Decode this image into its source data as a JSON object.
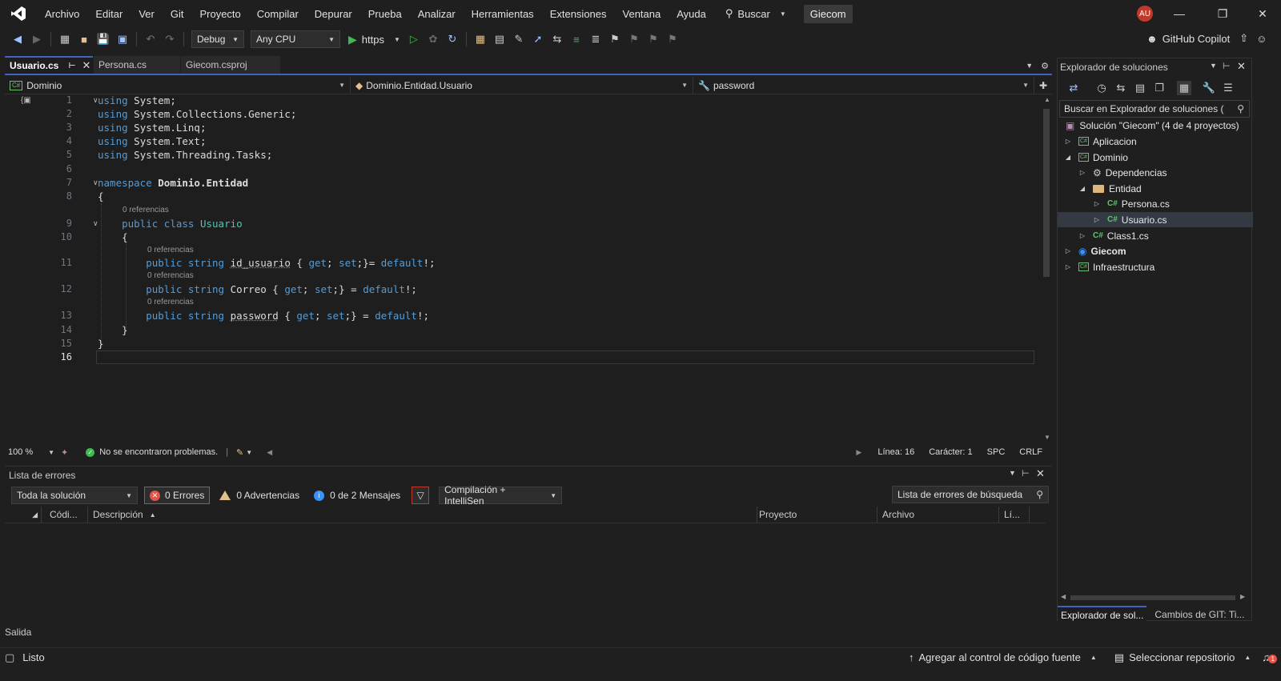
{
  "menu": [
    "Archivo",
    "Editar",
    "Ver",
    "Git",
    "Proyecto",
    "Compilar",
    "Depurar",
    "Prueba",
    "Analizar",
    "Herramientas",
    "Extensiones",
    "Ventana",
    "Ayuda"
  ],
  "search_label": "Buscar",
  "solution_badge": "Giecom",
  "avatar_initials": "AU",
  "toolbar": {
    "config": "Debug",
    "platform": "Any CPU",
    "run_target": "https",
    "copilot": "GitHub Copilot"
  },
  "tabs": [
    {
      "label": "Usuario.cs",
      "active": true
    },
    {
      "label": "Persona.cs",
      "active": false
    },
    {
      "label": "Giecom.csproj",
      "active": false
    }
  ],
  "nav": {
    "project": "Dominio",
    "type": "Dominio.Entidad.Usuario",
    "member": "password"
  },
  "code": {
    "line_numbers": [
      "1",
      "2",
      "3",
      "4",
      "5",
      "6",
      "7",
      "8",
      "9",
      "10",
      "11",
      "12",
      "13",
      "14",
      "15",
      "16"
    ],
    "refs_label": "0 referencias",
    "using": "using",
    "usings": [
      "System",
      "System.Collections.Generic",
      "System.Linq",
      "System.Text",
      "System.Threading.Tasks"
    ],
    "namespace_kw": "namespace",
    "namespace_name": "Dominio.Entidad",
    "public_kw": "public",
    "class_kw": "class",
    "class_name": "Usuario",
    "string_kw": "string",
    "get_kw": "get",
    "set_kw": "set",
    "default_kw": "default",
    "props": [
      "id_usuario",
      "Correo",
      "password"
    ]
  },
  "editor_status": {
    "zoom": "100 %",
    "problems": "No se encontraron problemas.",
    "line": "Línea: 16",
    "char": "Carácter: 1",
    "spc": "SPC",
    "eol": "CRLF"
  },
  "errors": {
    "title": "Lista de errores",
    "scope": "Toda la solución",
    "errors_label": "0 Errores",
    "warnings_label": "0 Advertencias",
    "messages_label": "0 de 2 Mensajes",
    "build_filter": "Compilación + IntelliSen",
    "search_placeholder": "Lista de errores de búsqueda",
    "columns": [
      "Códi...",
      "Descripción",
      "Proyecto",
      "Archivo",
      "Lí..."
    ]
  },
  "solution_explorer": {
    "title": "Explorador de soluciones",
    "search_placeholder": "Buscar en Explorador de soluciones (",
    "solution": "Solución \"Giecom\"  (4 de 4 proyectos)",
    "items": [
      "Aplicacion",
      "Dominio",
      "Dependencias",
      "Entidad",
      "Persona.cs",
      "Usuario.cs",
      "Class1.cs",
      "Giecom",
      "Infraestructura"
    ],
    "tabs": [
      "Explorador de sol...",
      "Cambios de GIT: Ti..."
    ]
  },
  "output_label": "Salida",
  "status": {
    "ready": "Listo",
    "add_source": "Agregar al control de código fuente",
    "select_repo": "Seleccionar repositorio",
    "notif_count": "1"
  },
  "colors": {
    "accent": "#3e63c0",
    "keyword": "#569cd6",
    "type": "#4ec9b0",
    "ok": "#3fb950",
    "error": "#e5534b"
  }
}
